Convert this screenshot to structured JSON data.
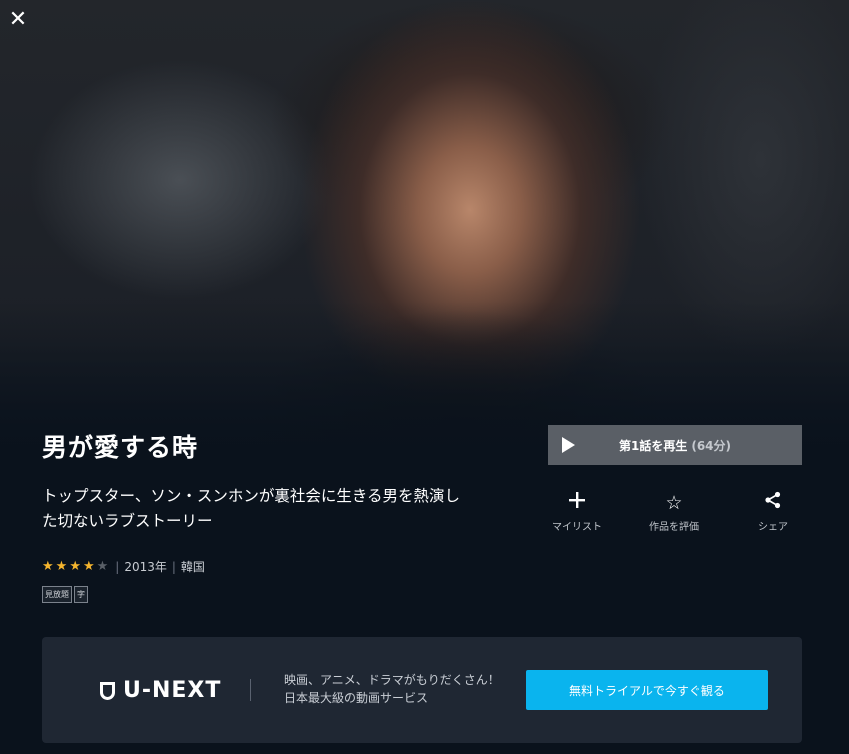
{
  "close_icon": "close-icon",
  "title": "男が愛する時",
  "description": "トップスター、ソン・スンホンが裏社会に生きる男を熱演した切ないラブストーリー",
  "rating": 4,
  "rating_max": 5,
  "year": "2013年",
  "country": "韓国",
  "badges": [
    "見放題",
    "字"
  ],
  "play": {
    "label": "第1話を再生",
    "duration": "(64分)"
  },
  "actions": {
    "mylist": "マイリスト",
    "rate": "作品を評価",
    "share": "シェア"
  },
  "banner": {
    "logo": "U-NEXT",
    "line1": "映画、アニメ、ドラマがもりだくさん！",
    "line2": "日本最大級の動画サービス",
    "cta": "無料トライアルで今すぐ観る"
  },
  "colors": {
    "accent": "#0ab4ee",
    "star": "#f5b52e",
    "background": "#0a121c"
  }
}
